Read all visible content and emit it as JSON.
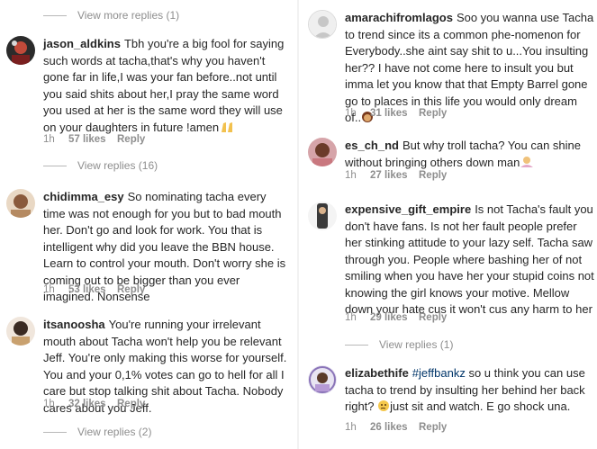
{
  "left": {
    "view_more_top": "View more replies (1)",
    "comments": [
      {
        "username": "jason_aldkins",
        "text": "Tbh you're a big fool for saying such words at tacha,that's why you haven't gone far in life,I was your fan before..not until you said shits about her,I pray the same word you used at her is the same word they will use on your  daughters in future !amen",
        "emoji": "praying-hands-emoji",
        "time": "1h",
        "likes": "57 likes",
        "reply": "Reply"
      },
      {
        "username": "chidimma_esy",
        "text": "So nominating tacha every time was not enough for you but to bad mouth her. Don't go and look for work. You that is intelligent why did you leave the BBN house. Learn to control your mouth. Don't worry she is coming out to be bigger than you ever imagined. Nonsense",
        "time": "1h",
        "likes": "53 likes",
        "reply": "Reply"
      },
      {
        "username": "itsanoosha",
        "text": "You're running your irrelevant mouth about Tacha won't help you be relevant Jeff. You're only making this worse for yourself. You and your 0,1% votes can go to hell for all I care but stop talking shit about Tacha. Nobody cares about you Jeff.",
        "time": "1h",
        "likes": "32 likes",
        "reply": "Reply"
      }
    ],
    "view_replies_16": "View replies (16)",
    "view_replies_2": "View replies (2)"
  },
  "right": {
    "comments": [
      {
        "username": "amarachifromlagos",
        "text": "Soo you wanna use Tacha to trend since its a common phe-nomenon for Everybody..she aint say shit to u...You insulting her?? I have not come here to insult you but imma let you know that that Empty Barrel gone go to places in this life you would only dream of..",
        "emoji": "woman-emoji",
        "time": "1h",
        "likes": "31 likes",
        "reply": "Reply"
      },
      {
        "username": "es_ch_nd",
        "text": "But why troll tacha? You can shine without bringing others down man",
        "emoji": "woman-shrugging-emoji",
        "time": "1h",
        "likes": "27 likes",
        "reply": "Reply"
      },
      {
        "username": "expensive_gift_empire",
        "text": "Is not Tacha's fault you don't have fans. Is not her fault people prefer her stinking attitude to your lazy self.  Tacha saw through you. People where bashing her of not smiling when you have her your stupid coins not knowing the girl knows your motive. Mellow down your hate cus it won't cus any harm to her",
        "time": "1h",
        "likes": "29 likes",
        "reply": "Reply"
      },
      {
        "username": "elizabethife",
        "mention": "#jeffbankz",
        "text_after": " so u think  you can use tacha to trend by insulting her behind her back right? ",
        "text_end": "just sit and watch. E go shock una.",
        "emoji": "thinking-face-emoji",
        "time": "1h",
        "likes": "26 likes",
        "reply": "Reply"
      }
    ],
    "view_replies_1": "View replies (1)"
  },
  "colors": {
    "text": "#262626",
    "meta": "#8e8e8e",
    "mention": "#003569"
  }
}
